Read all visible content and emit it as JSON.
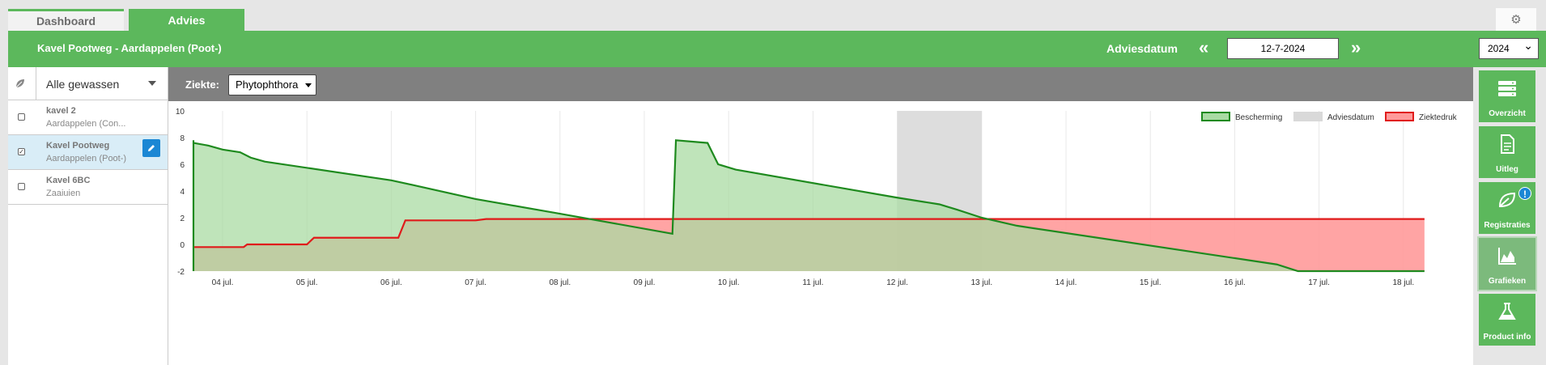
{
  "tabs": [
    {
      "label": "Dashboard"
    },
    {
      "label": "Advies"
    }
  ],
  "header": {
    "title": "Kavel Pootweg - Aardappelen (Poot-)",
    "adviesdatum_label": "Adviesdatum",
    "date_value": "12-7-2024",
    "year": "2024",
    "prev_arrow": "«",
    "next_arrow": "»"
  },
  "sidebar": {
    "filter_label": "Alle gewassen",
    "items": [
      {
        "name": "kavel 2",
        "sub": "Aardappelen (Con...",
        "checked": false
      },
      {
        "name": "Kavel Pootweg",
        "sub": "Aardappelen (Poot-)",
        "checked": true
      },
      {
        "name": "Kavel 6BC",
        "sub": "Zaaiuien",
        "checked": false
      }
    ]
  },
  "toolbar": {
    "ziekte_label": "Ziekte:",
    "ziekte_value": "Phytophthora"
  },
  "right_menu": [
    {
      "label": "Overzicht",
      "icon": "server-icon"
    },
    {
      "label": "Uitleg",
      "icon": "document-icon"
    },
    {
      "label": "Registraties",
      "icon": "leaf-icon",
      "badge": "!"
    },
    {
      "label": "Grafieken",
      "icon": "area-chart-icon"
    },
    {
      "label": "Product info",
      "icon": "flask-icon"
    }
  ],
  "colors": {
    "brand_green": "#5cb85c",
    "protection_line": "#1e8a1e",
    "protection_fill": "#a9dba3",
    "pressure_line": "#e01b1b",
    "pressure_fill": "#ff9a9a",
    "advice_band": "#d9d9d9"
  },
  "chart_data": {
    "type": "area",
    "ylim": [
      -2,
      10
    ],
    "yticks": [
      -2,
      0,
      2,
      4,
      6,
      8,
      10
    ],
    "x_range_days": [
      "2024-07-03",
      "2024-07-18"
    ],
    "xticks": [
      "04 jul.",
      "05 jul.",
      "06 jul.",
      "07 jul.",
      "08 jul.",
      "09 jul.",
      "10 jul.",
      "11 jul.",
      "12 jul.",
      "13 jul.",
      "14 jul.",
      "15 jul.",
      "16 jul.",
      "17 jul.",
      "18 jul."
    ],
    "legend_position": "top-right",
    "legend": [
      {
        "label": "Bescherming"
      },
      {
        "label": "Adviesdatum"
      },
      {
        "label": "Ziektedruk"
      }
    ],
    "advice_band": {
      "from": "2024-07-12",
      "to": "2024-07-13"
    },
    "series": [
      {
        "name": "Bescherming",
        "points": [
          [
            "2024-07-03T00:00",
            -2
          ],
          [
            "2024-07-03T09:00",
            -2
          ],
          [
            "2024-07-03T09:40",
            7.8
          ],
          [
            "2024-07-03T14:00",
            7.6
          ],
          [
            "2024-07-03T20:00",
            7.4
          ],
          [
            "2024-07-04T00:00",
            7.1
          ],
          [
            "2024-07-04T05:00",
            6.9
          ],
          [
            "2024-07-04T08:00",
            6.5
          ],
          [
            "2024-07-04T12:00",
            6.2
          ],
          [
            "2024-07-06T00:00",
            4.8
          ],
          [
            "2024-07-06T07:00",
            4.4
          ],
          [
            "2024-07-07T00:00",
            3.4
          ],
          [
            "2024-07-08T00:00",
            2.3
          ],
          [
            "2024-07-09T08:00",
            0.8
          ],
          [
            "2024-07-09T09:00",
            7.8
          ],
          [
            "2024-07-09T18:00",
            7.6
          ],
          [
            "2024-07-09T21:00",
            6.0
          ],
          [
            "2024-07-10T02:00",
            5.6
          ],
          [
            "2024-07-12T00:00",
            3.5
          ],
          [
            "2024-07-12T12:00",
            3.0
          ],
          [
            "2024-07-12T17:00",
            2.6
          ],
          [
            "2024-07-13T00:00",
            2.0
          ],
          [
            "2024-07-13T10:00",
            1.4
          ],
          [
            "2024-07-16T12:00",
            -1.5
          ],
          [
            "2024-07-16T18:00",
            -2
          ],
          [
            "2024-07-18T06:00",
            -2
          ]
        ]
      },
      {
        "name": "Ziektedruk",
        "points": [
          [
            "2024-07-03T00:00",
            -0.2
          ],
          [
            "2024-07-04T06:00",
            -0.2
          ],
          [
            "2024-07-04T07:00",
            0.0
          ],
          [
            "2024-07-05T00:00",
            0.0
          ],
          [
            "2024-07-05T02:00",
            0.5
          ],
          [
            "2024-07-06T02:00",
            0.5
          ],
          [
            "2024-07-06T04:00",
            1.8
          ],
          [
            "2024-07-07T00:00",
            1.8
          ],
          [
            "2024-07-07T03:00",
            1.9
          ],
          [
            "2024-07-18T06:00",
            1.9
          ]
        ]
      }
    ]
  }
}
